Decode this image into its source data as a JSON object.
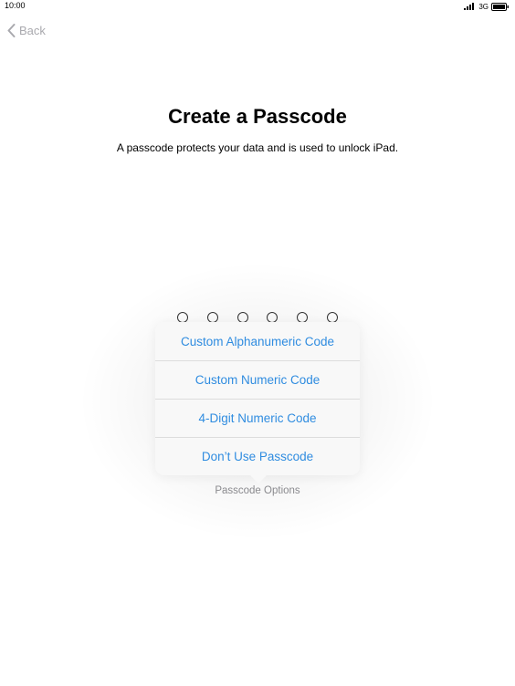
{
  "status_bar": {
    "time": "10:00",
    "network": "3G",
    "icons": [
      "signal-icon",
      "battery-icon"
    ]
  },
  "nav": {
    "back_label": "Back",
    "back_icon": "chevron-left-icon"
  },
  "header": {
    "title": "Create a Passcode",
    "subtitle": "A passcode protects your data and is used to unlock iPad."
  },
  "passcode": {
    "digits": 6,
    "entered": 0
  },
  "options_menu": {
    "items": [
      {
        "label": "Custom Alphanumeric Code"
      },
      {
        "label": "Custom Numeric Code"
      },
      {
        "label": "4-Digit Numeric Code"
      },
      {
        "label": "Don’t Use Passcode"
      }
    ],
    "caption": "Passcode Options"
  },
  "colors": {
    "accent": "#2f8ce0",
    "back_gray": "#a9a9ae",
    "caption_gray": "#8a8a8e"
  }
}
